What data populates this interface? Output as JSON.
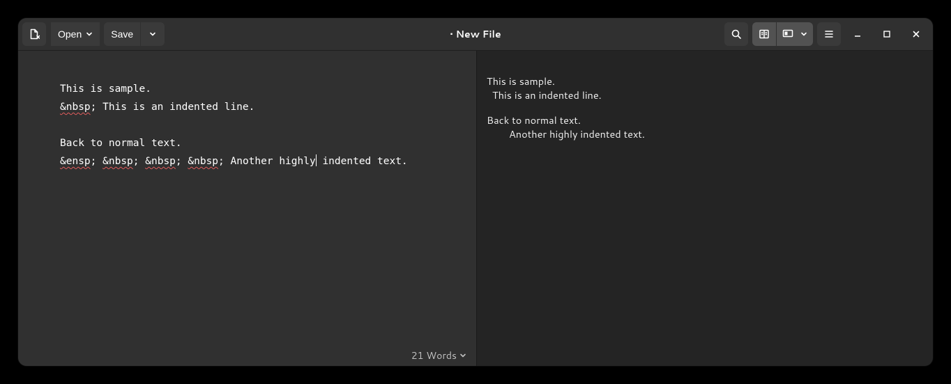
{
  "header": {
    "title": "• New File",
    "open_label": "Open",
    "save_label": "Save"
  },
  "editor": {
    "line1": "This is sample.",
    "line2_entity": "&nbsp",
    "line2_rest": "; This is an indented line.",
    "line3": "",
    "line4": "Back to normal text.",
    "line5_e1": "&ensp",
    "line5_e2": "&nbsp",
    "line5_e3": "&nbsp",
    "line5_e4": "&nbsp",
    "line5_sep": "; ",
    "line5_rest_a": "; Another highly",
    "line5_rest_b": " indented text."
  },
  "preview": {
    "p1a": "This is sample.",
    "p1b": "This is an indented line.",
    "p2a": "Back to normal text.",
    "p2b": "Another highly indented text."
  },
  "status": {
    "words": "21 Words"
  }
}
